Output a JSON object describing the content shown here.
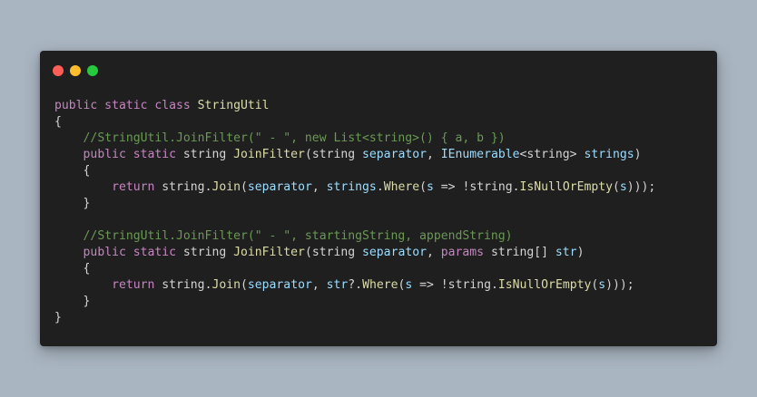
{
  "window": {
    "controls": [
      {
        "name": "close",
        "color": "#ff5f56"
      },
      {
        "name": "minimize",
        "color": "#ffbd2e"
      },
      {
        "name": "maximize",
        "color": "#27c93f"
      }
    ]
  },
  "code": {
    "language": "csharp",
    "theme": {
      "background": "#1f1f1f",
      "keyword": "#c586c0",
      "function": "#dcdcaa",
      "identifier": "#9cdcfe",
      "comment": "#6a9955",
      "plain": "#d4d4d4"
    },
    "lines": [
      [
        {
          "t": "keyword",
          "v": "public static class "
        },
        {
          "t": "type",
          "v": "StringUtil"
        }
      ],
      [
        {
          "t": "plain",
          "v": "{"
        }
      ],
      [
        {
          "t": "plain",
          "v": "    "
        },
        {
          "t": "comment",
          "v": "//StringUtil.JoinFilter(\" - \", new List<string>() { a, b })"
        }
      ],
      [
        {
          "t": "plain",
          "v": "    "
        },
        {
          "t": "keyword",
          "v": "public static "
        },
        {
          "t": "plain",
          "v": "string "
        },
        {
          "t": "func",
          "v": "JoinFilter"
        },
        {
          "t": "plain",
          "v": "(string "
        },
        {
          "t": "param",
          "v": "separator"
        },
        {
          "t": "plain",
          "v": ", "
        },
        {
          "t": "iface",
          "v": "IEnumerable"
        },
        {
          "t": "plain",
          "v": "<string> "
        },
        {
          "t": "param",
          "v": "strings"
        },
        {
          "t": "plain",
          "v": ")"
        }
      ],
      [
        {
          "t": "plain",
          "v": "    {"
        }
      ],
      [
        {
          "t": "plain",
          "v": "        "
        },
        {
          "t": "keyword",
          "v": "return "
        },
        {
          "t": "plain",
          "v": "string."
        },
        {
          "t": "func",
          "v": "Join"
        },
        {
          "t": "plain",
          "v": "("
        },
        {
          "t": "param",
          "v": "separator"
        },
        {
          "t": "plain",
          "v": ", "
        },
        {
          "t": "param",
          "v": "strings"
        },
        {
          "t": "plain",
          "v": "."
        },
        {
          "t": "func",
          "v": "Where"
        },
        {
          "t": "plain",
          "v": "("
        },
        {
          "t": "param",
          "v": "s"
        },
        {
          "t": "plain",
          "v": " => !string."
        },
        {
          "t": "func",
          "v": "IsNullOrEmpty"
        },
        {
          "t": "plain",
          "v": "("
        },
        {
          "t": "param",
          "v": "s"
        },
        {
          "t": "plain",
          "v": ")));"
        }
      ],
      [
        {
          "t": "plain",
          "v": "    }"
        }
      ],
      [
        {
          "t": "plain",
          "v": ""
        }
      ],
      [
        {
          "t": "plain",
          "v": "    "
        },
        {
          "t": "comment",
          "v": "//StringUtil.JoinFilter(\" - \", startingString, appendString)"
        }
      ],
      [
        {
          "t": "plain",
          "v": "    "
        },
        {
          "t": "keyword",
          "v": "public static "
        },
        {
          "t": "plain",
          "v": "string "
        },
        {
          "t": "func",
          "v": "JoinFilter"
        },
        {
          "t": "plain",
          "v": "(string "
        },
        {
          "t": "param",
          "v": "separator"
        },
        {
          "t": "plain",
          "v": ", "
        },
        {
          "t": "keyword",
          "v": "params "
        },
        {
          "t": "plain",
          "v": "string[] "
        },
        {
          "t": "param",
          "v": "str"
        },
        {
          "t": "plain",
          "v": ")"
        }
      ],
      [
        {
          "t": "plain",
          "v": "    {"
        }
      ],
      [
        {
          "t": "plain",
          "v": "        "
        },
        {
          "t": "keyword",
          "v": "return "
        },
        {
          "t": "plain",
          "v": "string."
        },
        {
          "t": "func",
          "v": "Join"
        },
        {
          "t": "plain",
          "v": "("
        },
        {
          "t": "param",
          "v": "separator"
        },
        {
          "t": "plain",
          "v": ", "
        },
        {
          "t": "param",
          "v": "str"
        },
        {
          "t": "plain",
          "v": "?."
        },
        {
          "t": "func",
          "v": "Where"
        },
        {
          "t": "plain",
          "v": "("
        },
        {
          "t": "param",
          "v": "s"
        },
        {
          "t": "plain",
          "v": " => !string."
        },
        {
          "t": "func",
          "v": "IsNullOrEmpty"
        },
        {
          "t": "plain",
          "v": "("
        },
        {
          "t": "param",
          "v": "s"
        },
        {
          "t": "plain",
          "v": ")));"
        }
      ],
      [
        {
          "t": "plain",
          "v": "    }"
        }
      ],
      [
        {
          "t": "plain",
          "v": "}"
        }
      ]
    ]
  }
}
